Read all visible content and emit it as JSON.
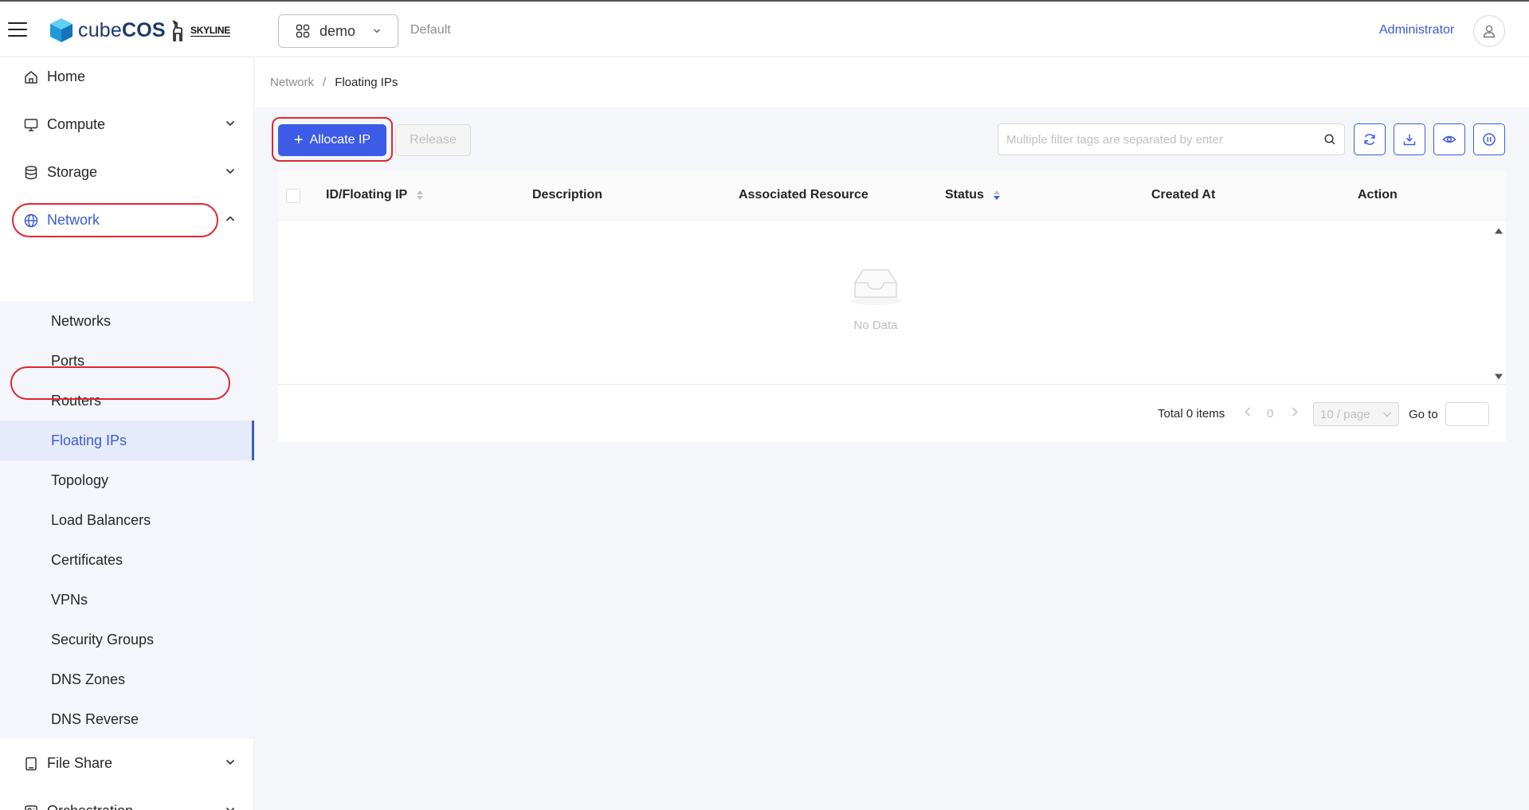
{
  "header": {
    "brand_prefix": "cube",
    "brand_suffix": "COS",
    "partner": "SKYLINE",
    "project": "demo",
    "domain": "Default",
    "user": "Administrator"
  },
  "sidebar": {
    "home": "Home",
    "compute": "Compute",
    "storage": "Storage",
    "network": "Network",
    "network_items": [
      "Networks",
      "Ports",
      "Routers",
      "Floating IPs",
      "Topology",
      "Load Balancers",
      "Certificates",
      "VPNs",
      "Security Groups",
      "DNS Zones",
      "DNS Reverse"
    ],
    "file_share": "File Share",
    "orchestration": "Orchestration",
    "active_item": "Floating IPs"
  },
  "breadcrumb": {
    "parent": "Network",
    "separator": "/",
    "current": "Floating IPs"
  },
  "toolbar": {
    "allocate_label": "Allocate IP",
    "release_label": "Release",
    "search_placeholder": "Multiple filter tags are separated by enter"
  },
  "table": {
    "columns": [
      "ID/Floating IP",
      "Description",
      "Associated Resource",
      "Status",
      "Created At",
      "Action"
    ],
    "rows": [],
    "empty_text": "No Data"
  },
  "pagination": {
    "total": "Total 0 items",
    "current_page": "0",
    "page_size": "10 / page",
    "goto_label": "Go to"
  },
  "colors": {
    "primary": "#3c5ce7",
    "highlight_ring": "#e0282e",
    "active_bg": "#e6ebfb"
  }
}
